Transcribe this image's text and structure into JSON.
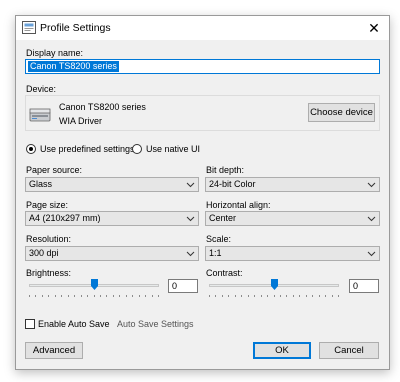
{
  "window": {
    "title": "Profile Settings",
    "close_glyph": "✕"
  },
  "display_name": {
    "label": "Display name:",
    "value": "Canon TS8200 series"
  },
  "device": {
    "label": "Device:",
    "name": "Canon TS8200 series",
    "driver": "WIA Driver",
    "choose_button": "Choose device",
    "icon": "scanner-icon"
  },
  "mode": {
    "predefined_label": "Use predefined settings",
    "native_label": "Use native UI",
    "selected": "predefined"
  },
  "paper_source": {
    "label": "Paper source:",
    "value": "Glass"
  },
  "bit_depth": {
    "label": "Bit depth:",
    "value": "24-bit Color"
  },
  "page_size": {
    "label": "Page size:",
    "value": "A4 (210x297 mm)"
  },
  "horizontal_align": {
    "label": "Horizontal align:",
    "value": "Center"
  },
  "resolution": {
    "label": "Resolution:",
    "value": "300 dpi"
  },
  "scale": {
    "label": "Scale:",
    "value": "1:1"
  },
  "brightness": {
    "label": "Brightness:",
    "value": "0",
    "level": 0.5
  },
  "contrast": {
    "label": "Contrast:",
    "value": "0",
    "level": 0.5
  },
  "auto_save": {
    "checkbox_label": "Enable Auto Save",
    "checked": false,
    "settings_link": "Auto Save Settings"
  },
  "footer": {
    "advanced": "Advanced",
    "ok": "OK",
    "cancel": "Cancel"
  },
  "colors": {
    "accent": "#0078d7",
    "dialog_bg": "#f0f0f0"
  }
}
